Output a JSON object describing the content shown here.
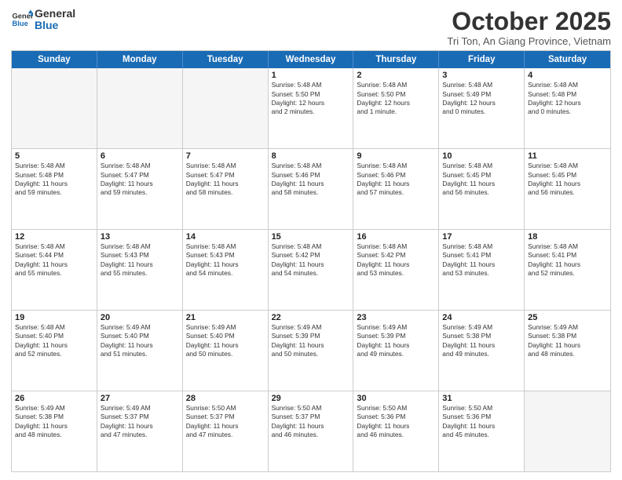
{
  "logo": {
    "line1": "General",
    "line2": "Blue"
  },
  "title": "October 2025",
  "location": "Tri Ton, An Giang Province, Vietnam",
  "days_of_week": [
    "Sunday",
    "Monday",
    "Tuesday",
    "Wednesday",
    "Thursday",
    "Friday",
    "Saturday"
  ],
  "weeks": [
    [
      {
        "day": "",
        "text": "",
        "empty": true
      },
      {
        "day": "",
        "text": "",
        "empty": true
      },
      {
        "day": "",
        "text": "",
        "empty": true
      },
      {
        "day": "1",
        "text": "Sunrise: 5:48 AM\nSunset: 5:50 PM\nDaylight: 12 hours\nand 2 minutes."
      },
      {
        "day": "2",
        "text": "Sunrise: 5:48 AM\nSunset: 5:50 PM\nDaylight: 12 hours\nand 1 minute."
      },
      {
        "day": "3",
        "text": "Sunrise: 5:48 AM\nSunset: 5:49 PM\nDaylight: 12 hours\nand 0 minutes."
      },
      {
        "day": "4",
        "text": "Sunrise: 5:48 AM\nSunset: 5:48 PM\nDaylight: 12 hours\nand 0 minutes."
      }
    ],
    [
      {
        "day": "5",
        "text": "Sunrise: 5:48 AM\nSunset: 5:48 PM\nDaylight: 11 hours\nand 59 minutes."
      },
      {
        "day": "6",
        "text": "Sunrise: 5:48 AM\nSunset: 5:47 PM\nDaylight: 11 hours\nand 59 minutes."
      },
      {
        "day": "7",
        "text": "Sunrise: 5:48 AM\nSunset: 5:47 PM\nDaylight: 11 hours\nand 58 minutes."
      },
      {
        "day": "8",
        "text": "Sunrise: 5:48 AM\nSunset: 5:46 PM\nDaylight: 11 hours\nand 58 minutes."
      },
      {
        "day": "9",
        "text": "Sunrise: 5:48 AM\nSunset: 5:46 PM\nDaylight: 11 hours\nand 57 minutes."
      },
      {
        "day": "10",
        "text": "Sunrise: 5:48 AM\nSunset: 5:45 PM\nDaylight: 11 hours\nand 56 minutes."
      },
      {
        "day": "11",
        "text": "Sunrise: 5:48 AM\nSunset: 5:45 PM\nDaylight: 11 hours\nand 56 minutes."
      }
    ],
    [
      {
        "day": "12",
        "text": "Sunrise: 5:48 AM\nSunset: 5:44 PM\nDaylight: 11 hours\nand 55 minutes."
      },
      {
        "day": "13",
        "text": "Sunrise: 5:48 AM\nSunset: 5:43 PM\nDaylight: 11 hours\nand 55 minutes."
      },
      {
        "day": "14",
        "text": "Sunrise: 5:48 AM\nSunset: 5:43 PM\nDaylight: 11 hours\nand 54 minutes."
      },
      {
        "day": "15",
        "text": "Sunrise: 5:48 AM\nSunset: 5:42 PM\nDaylight: 11 hours\nand 54 minutes."
      },
      {
        "day": "16",
        "text": "Sunrise: 5:48 AM\nSunset: 5:42 PM\nDaylight: 11 hours\nand 53 minutes."
      },
      {
        "day": "17",
        "text": "Sunrise: 5:48 AM\nSunset: 5:41 PM\nDaylight: 11 hours\nand 53 minutes."
      },
      {
        "day": "18",
        "text": "Sunrise: 5:48 AM\nSunset: 5:41 PM\nDaylight: 11 hours\nand 52 minutes."
      }
    ],
    [
      {
        "day": "19",
        "text": "Sunrise: 5:48 AM\nSunset: 5:40 PM\nDaylight: 11 hours\nand 52 minutes."
      },
      {
        "day": "20",
        "text": "Sunrise: 5:49 AM\nSunset: 5:40 PM\nDaylight: 11 hours\nand 51 minutes."
      },
      {
        "day": "21",
        "text": "Sunrise: 5:49 AM\nSunset: 5:40 PM\nDaylight: 11 hours\nand 50 minutes."
      },
      {
        "day": "22",
        "text": "Sunrise: 5:49 AM\nSunset: 5:39 PM\nDaylight: 11 hours\nand 50 minutes."
      },
      {
        "day": "23",
        "text": "Sunrise: 5:49 AM\nSunset: 5:39 PM\nDaylight: 11 hours\nand 49 minutes."
      },
      {
        "day": "24",
        "text": "Sunrise: 5:49 AM\nSunset: 5:38 PM\nDaylight: 11 hours\nand 49 minutes."
      },
      {
        "day": "25",
        "text": "Sunrise: 5:49 AM\nSunset: 5:38 PM\nDaylight: 11 hours\nand 48 minutes."
      }
    ],
    [
      {
        "day": "26",
        "text": "Sunrise: 5:49 AM\nSunset: 5:38 PM\nDaylight: 11 hours\nand 48 minutes."
      },
      {
        "day": "27",
        "text": "Sunrise: 5:49 AM\nSunset: 5:37 PM\nDaylight: 11 hours\nand 47 minutes."
      },
      {
        "day": "28",
        "text": "Sunrise: 5:50 AM\nSunset: 5:37 PM\nDaylight: 11 hours\nand 47 minutes."
      },
      {
        "day": "29",
        "text": "Sunrise: 5:50 AM\nSunset: 5:37 PM\nDaylight: 11 hours\nand 46 minutes."
      },
      {
        "day": "30",
        "text": "Sunrise: 5:50 AM\nSunset: 5:36 PM\nDaylight: 11 hours\nand 46 minutes."
      },
      {
        "day": "31",
        "text": "Sunrise: 5:50 AM\nSunset: 5:36 PM\nDaylight: 11 hours\nand 45 minutes."
      },
      {
        "day": "",
        "text": "",
        "empty": true
      }
    ]
  ]
}
